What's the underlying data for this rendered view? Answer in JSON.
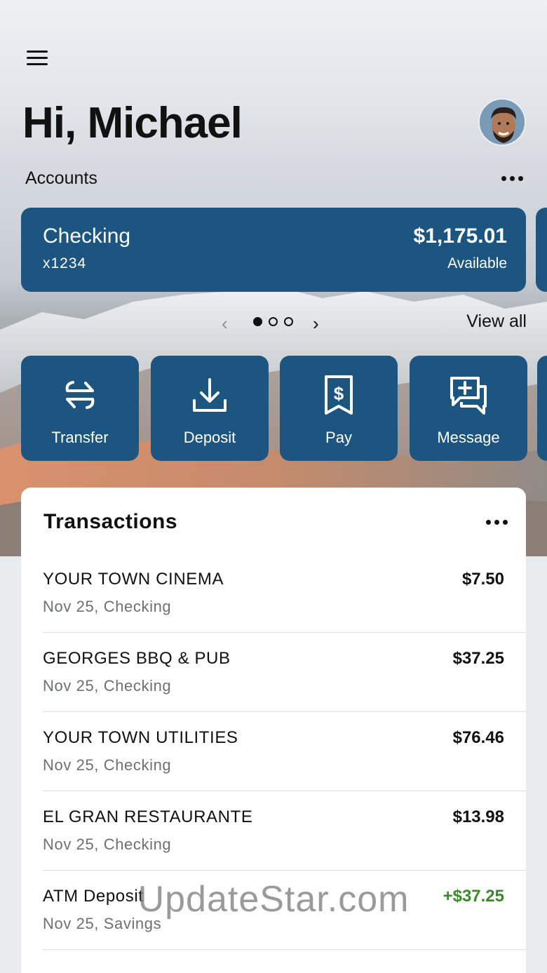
{
  "header": {
    "greeting": "Hi, Michael",
    "accounts_label": "Accounts"
  },
  "account_card": {
    "name": "Checking",
    "number": "x1234",
    "balance": "$1,175.01",
    "balance_label": "Available"
  },
  "pager": {
    "prev_icon": "chevron-left-icon",
    "next_icon": "chevron-right-icon",
    "current_page": 1,
    "total_pages": 3,
    "view_all_label": "View all"
  },
  "actions": [
    {
      "label": "Transfer",
      "icon": "transfer-arrows-icon"
    },
    {
      "label": "Deposit",
      "icon": "download-tray-icon"
    },
    {
      "label": "Pay",
      "icon": "dollar-receipt-icon"
    },
    {
      "label": "Message",
      "icon": "message-plus-icon"
    }
  ],
  "transactions": {
    "title": "Transactions",
    "rows": [
      {
        "merchant": "YOUR TOWN CINEMA",
        "meta": "Nov 25, Checking",
        "amount": "$7.50",
        "credit": false
      },
      {
        "merchant": "GEORGES BBQ & PUB",
        "meta": "Nov 25, Checking",
        "amount": "$37.25",
        "credit": false
      },
      {
        "merchant": "YOUR TOWN UTILITIES",
        "meta": "Nov 25, Checking",
        "amount": "$76.46",
        "credit": false
      },
      {
        "merchant": "EL GRAN RESTAURANTE",
        "meta": "Nov 25, Checking",
        "amount": "$13.98",
        "credit": false
      },
      {
        "merchant": "ATM Deposit",
        "meta": "Nov 25, Savings",
        "amount": "+$37.25",
        "credit": true
      }
    ]
  },
  "watermark": "UpdateStar.com",
  "colors": {
    "card_blue": "#1c5580",
    "credit_green": "#3a8a2b",
    "panel_white": "#ffffff"
  }
}
